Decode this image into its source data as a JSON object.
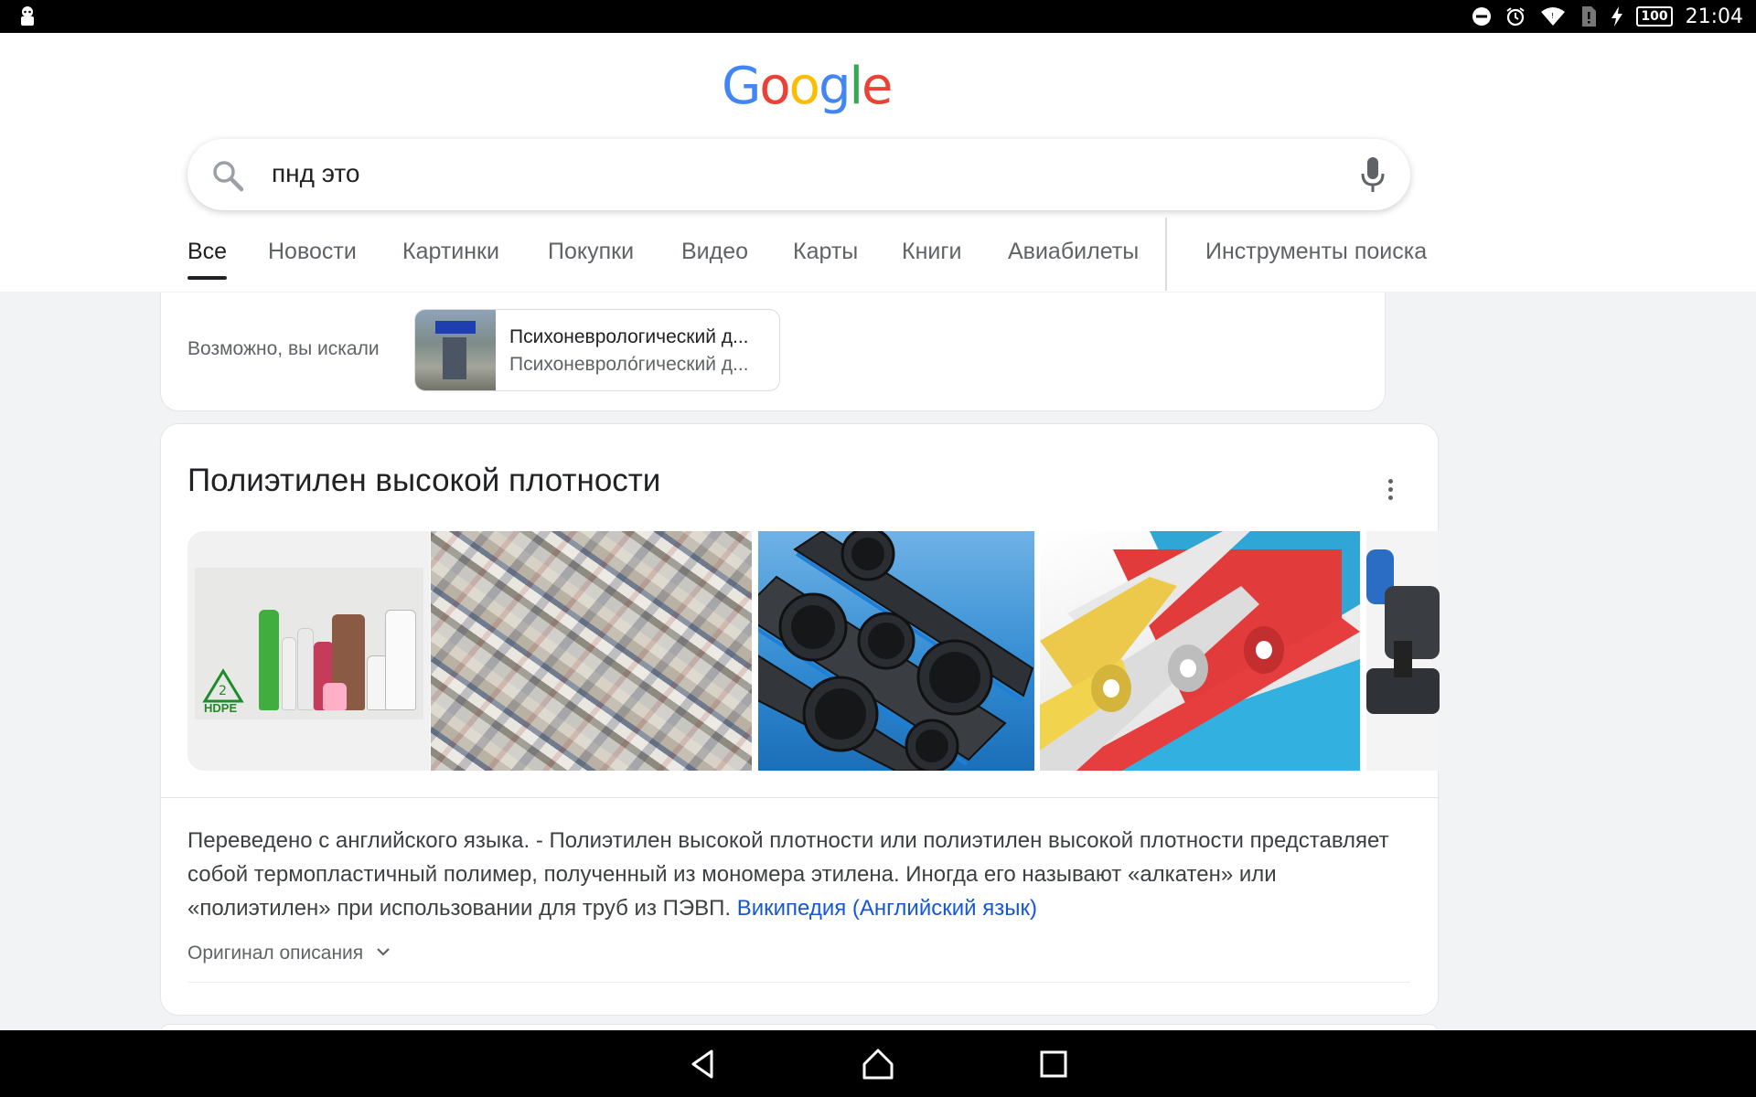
{
  "status_bar": {
    "time": "21:04",
    "battery": "100"
  },
  "logo": {
    "letters": [
      "G",
      "o",
      "o",
      "g",
      "l",
      "e"
    ],
    "colors": [
      "#4285f4",
      "#ea4335",
      "#fbbc05",
      "#4285f4",
      "#34a853",
      "#ea4335"
    ]
  },
  "search": {
    "query": "пнд это"
  },
  "tabs": [
    {
      "label": "Все",
      "active": true
    },
    {
      "label": "Новости",
      "active": false
    },
    {
      "label": "Картинки",
      "active": false
    },
    {
      "label": "Покупки",
      "active": false
    },
    {
      "label": "Видео",
      "active": false
    },
    {
      "label": "Карты",
      "active": false
    },
    {
      "label": "Книги",
      "active": false
    },
    {
      "label": "Авиабилеты",
      "active": false
    },
    {
      "label": "Инструменты поиска",
      "active": false
    }
  ],
  "suggestion": {
    "label": "Возможно, вы искали",
    "title": "Психоневрологический д...",
    "subtitle": "Психоневроло́гический д..."
  },
  "knowledge_panel": {
    "title": "Полиэтилен высокой плотности",
    "image_badge": "HDPE",
    "description": "Переведено с английского языка. - Полиэтилен высокой плотности или полиэтилен высокой плотности представляет собой термопластичный полимер, полученный из мономера этилена. Иногда его называют «алкатен» или «полиэтилен» при использовании для труб из ПЭВП.",
    "source_link": "Википедия (Английский язык)",
    "original_toggle": "Оригинал описания"
  },
  "colors": {
    "link": "#1558d6",
    "text_primary": "#202124",
    "text_secondary": "#5f6368",
    "background": "#f1f3f4"
  },
  "icons": {
    "status_left": "android-debug-icon",
    "status_right": [
      "do-not-disturb-icon",
      "alarm-icon",
      "wifi-icon",
      "sim-alert-icon",
      "charging-icon",
      "battery-icon"
    ],
    "search": "search-icon",
    "voice": "mic-icon",
    "menu": "more-vert-icon",
    "expand": "chevron-down-icon",
    "nav": [
      "back-icon",
      "home-icon",
      "recents-icon"
    ]
  }
}
